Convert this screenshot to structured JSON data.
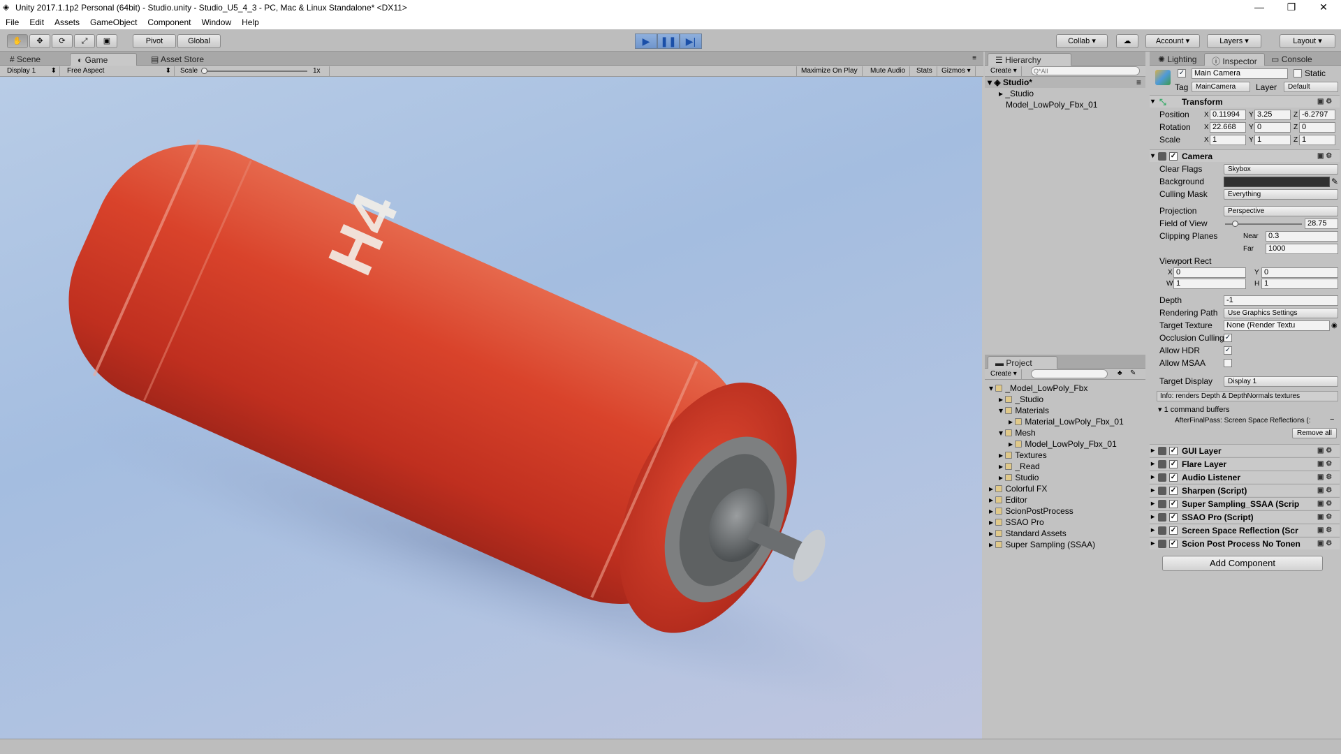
{
  "titlebar": {
    "title": "Unity 2017.1.1p2 Personal (64bit) - Studio.unity - Studio_U5_4_3 - PC, Mac & Linux Standalone* <DX11>",
    "min": "—",
    "max": "❐",
    "close": "✕"
  },
  "menu": [
    "File",
    "Edit",
    "Assets",
    "GameObject",
    "Component",
    "Window",
    "Help"
  ],
  "toolbar": {
    "tools": [
      "hand-icon",
      "move-icon",
      "rotate-icon",
      "scale-icon",
      "rect-icon"
    ],
    "pivot": "Pivot",
    "global": "Global",
    "collab": "Collab",
    "account": "Account",
    "layers": "Layers",
    "layout": "Layout"
  },
  "game": {
    "tabs": [
      "Scene",
      "Game",
      "Asset Store"
    ],
    "display": "Display 1",
    "aspect": "Free Aspect",
    "scale_label": "Scale",
    "scale_value": "1x",
    "options": [
      "Maximize On Play",
      "Mute Audio",
      "Stats",
      "Gizmos"
    ],
    "model_text": "H4"
  },
  "hierarchy": {
    "title": "Hierarchy",
    "create": "Create",
    "search_placeholder": "Q*All",
    "scene": "Studio*",
    "items": [
      "_Studio",
      "Model_LowPoly_Fbx_01"
    ]
  },
  "project": {
    "title": "Project",
    "create": "Create",
    "items": [
      {
        "label": "_Model_LowPoly_Fbx",
        "indent": 0,
        "open": true
      },
      {
        "label": "_Studio",
        "indent": 1,
        "open": false
      },
      {
        "label": "Materials",
        "indent": 1,
        "open": true
      },
      {
        "label": "Material_LowPoly_Fbx_01",
        "indent": 2,
        "open": false
      },
      {
        "label": "Mesh",
        "indent": 1,
        "open": true
      },
      {
        "label": "Model_LowPoly_Fbx_01",
        "indent": 2,
        "open": false
      },
      {
        "label": "Textures",
        "indent": 1,
        "open": false
      },
      {
        "label": "_Read",
        "indent": 1,
        "open": false
      },
      {
        "label": "Studio",
        "indent": 1,
        "open": false
      },
      {
        "label": "Colorful FX",
        "indent": 0,
        "open": false
      },
      {
        "label": "Editor",
        "indent": 0,
        "open": false
      },
      {
        "label": "ScionPostProcess",
        "indent": 0,
        "open": false
      },
      {
        "label": "SSAO Pro",
        "indent": 0,
        "open": false
      },
      {
        "label": "Standard Assets",
        "indent": 0,
        "open": false
      },
      {
        "label": "Super Sampling (SSAA)",
        "indent": 0,
        "open": false
      }
    ]
  },
  "inspector": {
    "tabs": [
      "Lighting",
      "Inspector",
      "Console"
    ],
    "object_name": "Main Camera",
    "static": "Static",
    "tag_label": "Tag",
    "tag": "MainCamera",
    "layer_label": "Layer",
    "layer": "Default",
    "transform": {
      "title": "Transform",
      "position_label": "Position",
      "position": [
        "0.11994",
        "3.25",
        "-6.2797"
      ],
      "rotation_label": "Rotation",
      "rotation": [
        "22.668",
        "0",
        "0"
      ],
      "scale_label": "Scale",
      "scale": [
        "1",
        "1",
        "1"
      ]
    },
    "camera": {
      "title": "Camera",
      "clear_flags_label": "Clear Flags",
      "clear_flags": "Skybox",
      "background_label": "Background",
      "culling_label": "Culling Mask",
      "culling": "Everything",
      "projection_label": "Projection",
      "projection": "Perspective",
      "fov_label": "Field of View",
      "fov": "28.75",
      "clip_label": "Clipping Planes",
      "near_label": "Near",
      "near": "0.3",
      "far_label": "Far",
      "far": "1000",
      "viewport_label": "Viewport Rect",
      "vx": "0",
      "vy": "0",
      "vw": "1",
      "vh": "1",
      "depth_label": "Depth",
      "depth": "-1",
      "render_path_label": "Rendering Path",
      "render_path": "Use Graphics Settings",
      "target_tex_label": "Target Texture",
      "target_tex": "None (Render Textu",
      "occlusion_label": "Occlusion Culling",
      "hdr_label": "Allow HDR",
      "msaa_label": "Allow MSAA",
      "target_display_label": "Target Display",
      "target_display": "Display 1",
      "info": "Info: renders Depth & DepthNormals textures",
      "buffers": "1 command buffers",
      "afterpass": "AfterFinalPass: Screen Space Reflections (:",
      "remove_all": "Remove all"
    },
    "components": [
      "GUI Layer",
      "Flare Layer",
      "Audio Listener",
      "Sharpen (Script)",
      "Super Sampling_SSAA (Scrip",
      "SSAO Pro (Script)",
      "Screen Space Reflection (Scr",
      "Scion Post Process No Tonen"
    ],
    "add_component": "Add Component"
  },
  "colors": {
    "accent": "#7aa0d8",
    "cylinder": "#d8412b",
    "sky": "#a9c0e2"
  }
}
